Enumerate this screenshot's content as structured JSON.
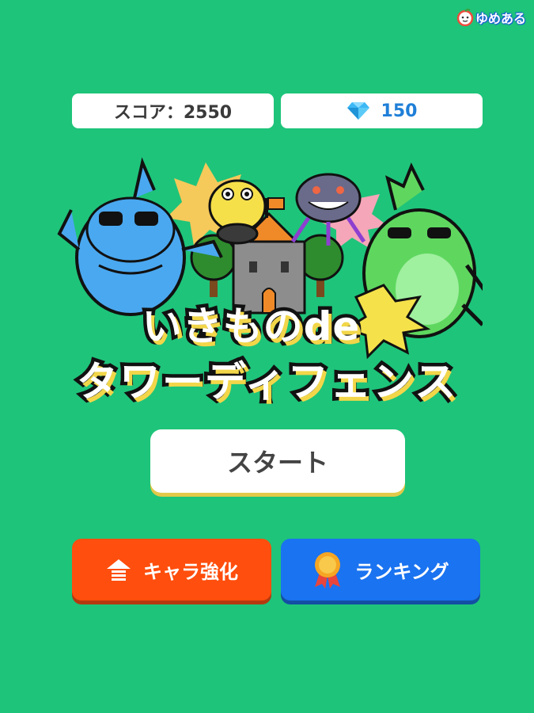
{
  "brand": {
    "name": "ゆめある"
  },
  "score": {
    "text": "スコア：2550"
  },
  "gems": {
    "icon": "diamond-icon",
    "count": "150"
  },
  "title": {
    "line1": "いきものde",
    "line2": "タワーディフェンス"
  },
  "buttons": {
    "start_label": "スタート",
    "upgrade_label": "キャラ強化",
    "ranking_label": "ランキング"
  },
  "colors": {
    "background": "#1ec47a",
    "upgrade": "#ff4e0d",
    "ranking": "#1a73f0",
    "gem": "#1f7fd8"
  }
}
